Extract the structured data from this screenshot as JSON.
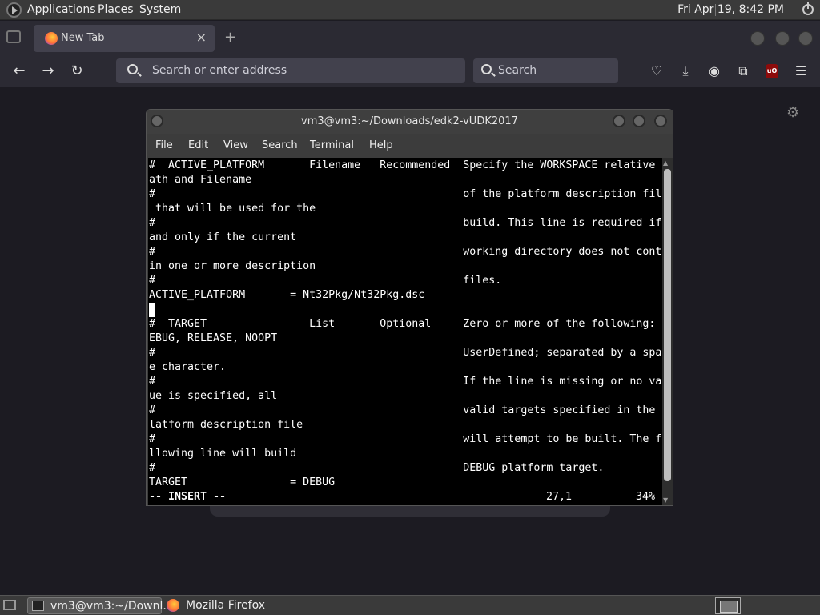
{
  "top_panel": {
    "menus": [
      "Applications",
      "Places",
      "System"
    ],
    "clock": "Fri Apr 19,  8:42 PM"
  },
  "firefox": {
    "tab_title": "New Tab",
    "url_placeholder": "Search or enter address",
    "search_placeholder": "Search",
    "accent": "#2b2a33"
  },
  "terminal": {
    "title": "vm3@vm3:~/Downloads/edk2-vUDK2017",
    "menu": [
      "File",
      "Edit",
      "View",
      "Search",
      "Terminal",
      "Help"
    ],
    "lines": [
      "#  ACTIVE_PLATFORM       Filename   Recommended  Specify the WORKSPACE relative P",
      "ath and Filename",
      "#                                                of the platform description file",
      " that will be used for the",
      "#                                                build. This line is required if",
      "and only if the current",
      "#                                                working directory does not conta",
      "in one or more description",
      "#                                                files.",
      "ACTIVE_PLATFORM       = Nt32Pkg/Nt32Pkg.dsc",
      "",
      "#  TARGET                List       Optional     Zero or more of the following: D",
      "EBUG, RELEASE, NOOPT",
      "#                                                UserDefined; separated by a spac",
      "e character.",
      "#                                                If the line is missing or no val",
      "ue is specified, all",
      "#                                                valid targets specified in the p",
      "latform description file",
      "#                                                will attempt to be built. The fo",
      "llowing line will build",
      "#                                                DEBUG platform target.",
      "TARGET                = DEBUG"
    ],
    "cursor_line": 10,
    "status": {
      "mode": "-- INSERT --",
      "position": "27,1",
      "percent": "34%"
    }
  },
  "bottom_panel": {
    "tasks": [
      "vm3@vm3:~/Downl...",
      "Mozilla Firefox"
    ]
  }
}
